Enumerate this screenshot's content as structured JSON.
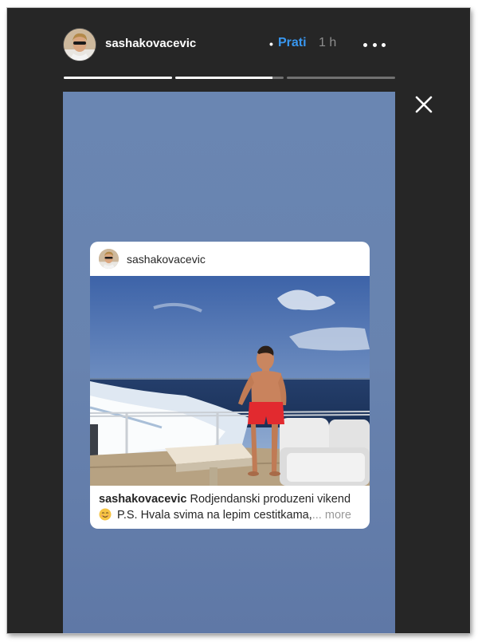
{
  "story": {
    "username": "sashakovacevic",
    "separator": "•",
    "follow_label": "Prati",
    "time_ago": "1 h",
    "segments": [
      {
        "progress": 1.0
      },
      {
        "progress": 0.9
      },
      {
        "progress": 0.0
      }
    ],
    "background_color": "#6883af",
    "icons": {
      "more": "more-horizontal-icon",
      "close": "close-icon"
    }
  },
  "shared_post": {
    "username": "sashakovacevic",
    "caption_user": "sashakovacevic",
    "caption_line1": " Rodjendanski produzeni vikend",
    "caption_line2": " P.S. Hvala svima na lepim cestitkama,",
    "ellipsis": "...",
    "more_label": " more",
    "emoji": "smiling-face-icon",
    "photo": "man-in-red-shorts-on-yacht-deck"
  },
  "colors": {
    "accent": "#3897f0",
    "frame": "#262626",
    "muted": "#8e8e8e"
  }
}
